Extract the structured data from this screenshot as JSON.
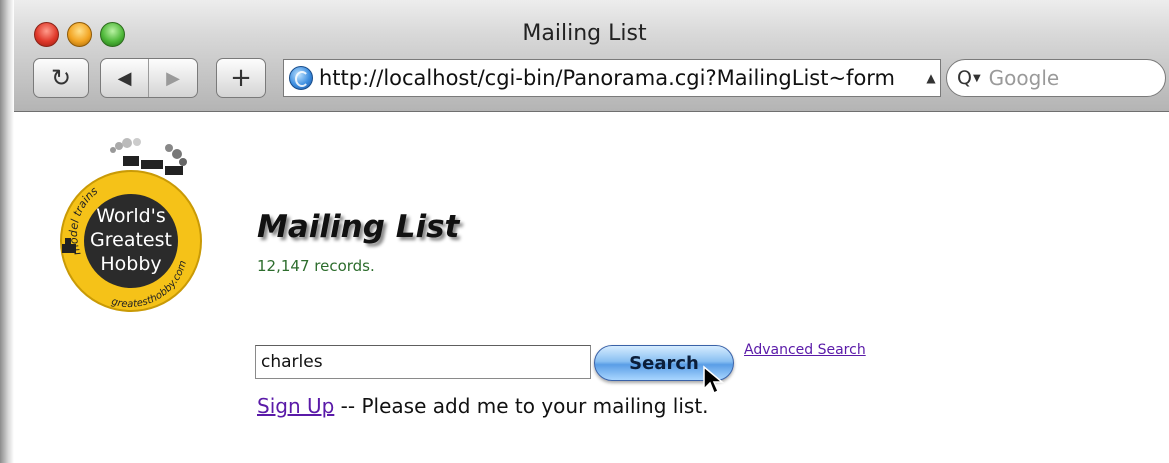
{
  "window": {
    "title": "Mailing List"
  },
  "toolbar": {
    "reload_icon": "reload-icon",
    "back_icon": "back-arrow-icon",
    "forward_icon": "forward-arrow-icon",
    "add_icon": "plus-icon",
    "reload_glyph": "↻",
    "back_glyph": "◀",
    "forward_glyph": "▶",
    "add_glyph": "+",
    "url": "http://localhost/cgi-bin/Panorama.cgi?MailingList~form",
    "search_placeholder": "Google",
    "search_glyph": "Q"
  },
  "page": {
    "logo": {
      "top_text": "model trains",
      "line1": "World's",
      "line2": "Greatest",
      "line3": "Hobby",
      "bottom_text": "greatesthobby.com",
      "colors": {
        "ring": "#f5c218",
        "center": "#2b2b2b",
        "text": "#ffffff"
      }
    },
    "title": "Mailing List",
    "record_count": "12,147 records.",
    "search": {
      "query_value": "charles",
      "button_label": "Search",
      "advanced_label": "Advanced Search"
    },
    "signup": {
      "link_label": "Sign Up",
      "text": " -- Please add me to your mailing list."
    }
  },
  "colors": {
    "link": "#5a1aa8",
    "record_count": "#2d6d2d",
    "search_button": "#5a9ee6"
  }
}
